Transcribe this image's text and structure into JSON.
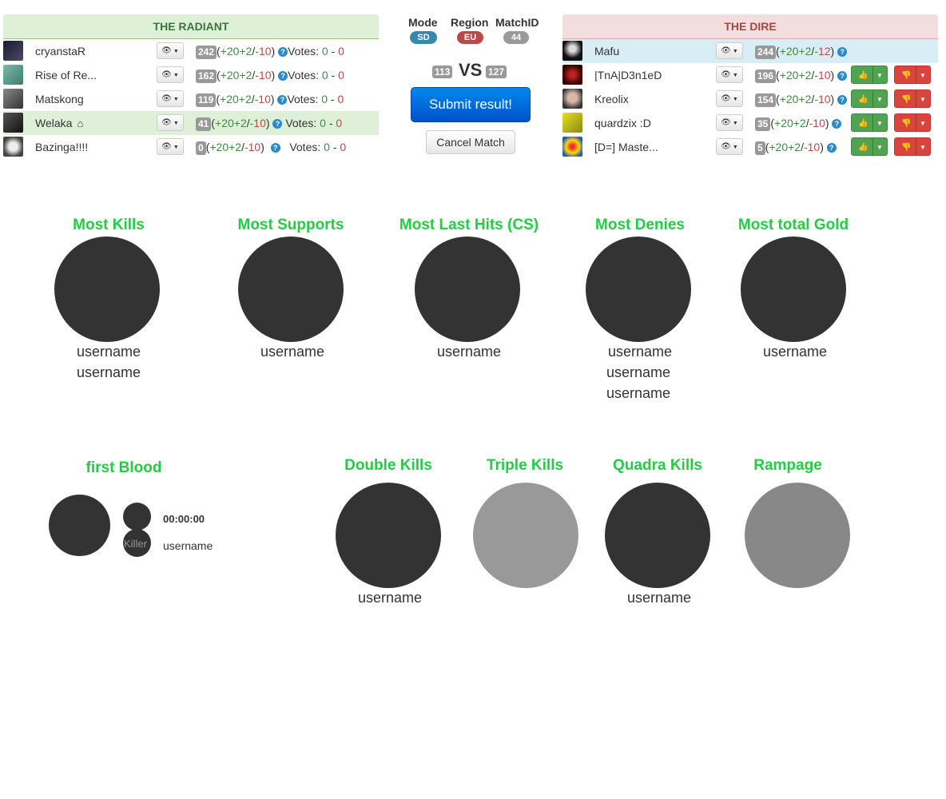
{
  "radiant": {
    "title": "THE RADIANT",
    "players": [
      {
        "name": "cryanstaR",
        "mmr": "242",
        "gain": "+20",
        "bonus": "+2",
        "loss": "-10",
        "votes_label": "Votes:",
        "votes_up": "0",
        "votes_down": "0"
      },
      {
        "name": "Rise of Re...",
        "mmr": "162",
        "gain": "+20",
        "bonus": "+2",
        "loss": "-10",
        "votes_label": "Votes:",
        "votes_up": "0",
        "votes_down": "0"
      },
      {
        "name": "Matskong",
        "mmr": "119",
        "gain": "+20",
        "bonus": "+2",
        "loss": "-10",
        "votes_label": "Votes:",
        "votes_up": "0",
        "votes_down": "0"
      },
      {
        "name": "Welaka",
        "mmr": "41",
        "gain": "+20",
        "bonus": "+2",
        "loss": "-10",
        "votes_label": "Votes:",
        "votes_up": "0",
        "votes_down": "0"
      },
      {
        "name": "Bazinga!!!!",
        "mmr": "0",
        "gain": "+20",
        "bonus": "+2",
        "loss": "-10",
        "votes_label": "Votes:",
        "votes_up": "0",
        "votes_down": "0"
      }
    ]
  },
  "dire": {
    "title": "THE DIRE",
    "players": [
      {
        "name": "Mafu",
        "mmr": "244",
        "gain": "+20",
        "bonus": "+2",
        "loss": "-12"
      },
      {
        "name": "|TnA|D3n1eD",
        "mmr": "196",
        "gain": "+20",
        "bonus": "+2",
        "loss": "-10"
      },
      {
        "name": "Kreolix",
        "mmr": "154",
        "gain": "+20",
        "bonus": "+2",
        "loss": "-10"
      },
      {
        "name": "quardzix :D",
        "mmr": "35",
        "gain": "+20",
        "bonus": "+2",
        "loss": "-10"
      },
      {
        "name": "[D=] Maste...",
        "mmr": "5",
        "gain": "+20",
        "bonus": "+2",
        "loss": "-10"
      }
    ]
  },
  "match": {
    "mode_label": "Mode",
    "mode_value": "SD",
    "region_label": "Region",
    "region_value": "EU",
    "matchid_label": "MatchID",
    "matchid_value": "44",
    "radiant_score": "113",
    "vs": "VS",
    "dire_score": "127",
    "submit_label": "Submit result!",
    "cancel_label": "Cancel Match"
  },
  "awards": {
    "most_kills": {
      "title": "Most Kills",
      "users": [
        "username",
        "username"
      ]
    },
    "most_supports": {
      "title": "Most Supports",
      "users": [
        "username"
      ]
    },
    "most_last_hits": {
      "title": "Most Last Hits (CS)",
      "users": [
        "username"
      ]
    },
    "most_denies": {
      "title": "Most Denies",
      "users": [
        "username",
        "username",
        "username"
      ]
    },
    "most_gold": {
      "title": "Most total Gold",
      "users": [
        "username"
      ]
    },
    "first_blood": {
      "title": "first Blood",
      "time": "00:00:00",
      "killer_label": "Killer",
      "user": "username"
    },
    "double_kills": {
      "title": "Double Kills",
      "user": "username"
    },
    "triple_kills": {
      "title": "Triple Kills"
    },
    "quadra_kills": {
      "title": "Quadra Kills",
      "user": "username"
    },
    "rampage": {
      "title": "Rampage"
    }
  },
  "colors": {
    "award_title": "#22cc44",
    "circle_dark": "#333333",
    "circle_gray": "#999999",
    "mode_badge": "#3a87ad",
    "region_badge": "#b94a48",
    "matchid_badge": "#999999",
    "vote_up": "#51a351",
    "vote_down": "#d9453d"
  },
  "icons": {
    "view": "eye-icon",
    "help": "question-circle-icon",
    "captain": "home-icon",
    "vote_up": "thumbs-up-icon",
    "vote_down": "thumbs-down-icon"
  }
}
